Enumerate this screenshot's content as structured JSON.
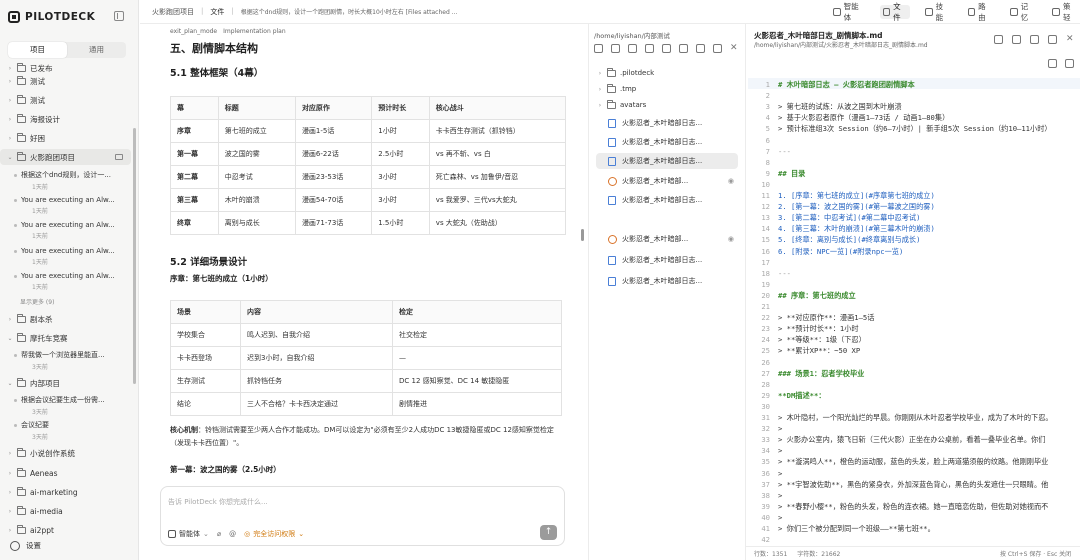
{
  "app": {
    "name": "PILOTDECK"
  },
  "sidebar": {
    "tabs": [
      "项目",
      "通用"
    ],
    "items": [
      {
        "label": "已发布",
        "type": "folder"
      },
      {
        "label": "测试",
        "type": "folder"
      },
      {
        "label": "测试",
        "type": "folder"
      },
      {
        "label": "海报设计",
        "type": "folder"
      },
      {
        "label": "好困",
        "type": "folder"
      },
      {
        "label": "火影跑团项目",
        "type": "folder-open"
      }
    ],
    "conversations": [
      {
        "title": "根据这个dnd规则，设计一...",
        "time": "1天前"
      },
      {
        "title": "You are executing an Alw...",
        "time": "1天前"
      },
      {
        "title": "You are executing an Alw...",
        "time": "1天前"
      },
      {
        "title": "You are executing an Alw...",
        "time": "1天前"
      },
      {
        "title": "You are executing an Alw...",
        "time": "1天前"
      }
    ],
    "show_more": "显示更多 (9)",
    "items2": [
      {
        "label": "剧本杀"
      },
      {
        "label": "摩托车竞赛"
      }
    ],
    "conv2": {
      "title": "帮我做一个浏览器里能直...",
      "time": "3天前"
    },
    "items3": [
      {
        "label": "内部项目"
      }
    ],
    "conv3": [
      {
        "title": "根据会议纪要生成一份需...",
        "time": "3天前"
      },
      {
        "title": "会议纪要",
        "time": "3天前"
      }
    ],
    "items4": [
      {
        "label": "小说创作系统"
      },
      {
        "label": "Aeneas"
      },
      {
        "label": "ai-marketing"
      },
      {
        "label": "ai-media"
      },
      {
        "label": "ai2ppt"
      }
    ],
    "settings": "设置"
  },
  "breadcrumb": {
    "project": "火影跑团项目",
    "section": "文件",
    "task": "根据这个dnd规则，设计一个跑团剧情，时长大概10小时左右 [Files attached by u..."
  },
  "topnav": [
    "智能体",
    "文件",
    "技能",
    "路由",
    "记忆",
    "策轻"
  ],
  "doc_header": {
    "mode": "exit_plan_mode",
    "title": "Implementation plan"
  },
  "doc": {
    "h2": "五、剧情脚本结构",
    "h3a": "5.1 整体框架（4幕）",
    "table1": {
      "headers": [
        "幕",
        "标题",
        "对应原作",
        "预计时长",
        "核心战斗"
      ],
      "rows": [
        [
          "序章",
          "第七班的成立",
          "漫画1-5话",
          "1小时",
          "卡卡西生存测试（抓铃铛）"
        ],
        [
          "第一幕",
          "波之国的雾",
          "漫画6-22话",
          "2.5小时",
          "vs 再不斩、vs 白"
        ],
        [
          "第二幕",
          "中忍考试",
          "漫画23-53话",
          "3小时",
          "死亡森林、vs 加鲁伊/音忍"
        ],
        [
          "第三幕",
          "木叶的崩溃",
          "漫画54-70话",
          "3小时",
          "vs 我爱罗、三代vs大蛇丸"
        ],
        [
          "终章",
          "离别与成长",
          "漫画71-73话",
          "1.5小时",
          "vs 大蛇丸（佐助战）"
        ]
      ]
    },
    "h3b": "5.2 详细场景设计",
    "h4a": "序章：第七班的成立（1小时）",
    "table2": {
      "headers": [
        "场景",
        "内容",
        "检定"
      ],
      "rows": [
        [
          "学校集合",
          "鸣人迟到、自我介绍",
          "社交检定"
        ],
        [
          "卡卡西登场",
          "迟到3小时，自我介绍",
          "—"
        ],
        [
          "生存测试",
          "抓铃铛任务",
          "DC 12 感知察觉、DC 14 敏捷隐匿"
        ],
        [
          "结论",
          "三人不合格？卡卡西决定通过",
          "剧情推进"
        ]
      ]
    },
    "core_label": "核心机制",
    "core_text": "：铃铛测试需要至少两人合作才能成功。DM可以设定为\"必须有至少2人成功DC 13敏捷隐匿或DC 12感知察觉检定（发现卡卡西位置）\"。",
    "h4b": "第一幕：波之国的雾（2.5小时）"
  },
  "chat": {
    "placeholder": "告诉 PilotDeck 你想完成什么...",
    "agent": "智能体",
    "permission": "完全访问权限"
  },
  "files": {
    "path": "/home/liyishan/内部测试",
    "items": [
      {
        "name": ".pilotdeck",
        "type": "folder"
      },
      {
        "name": ".tmp",
        "type": "folder"
      },
      {
        "name": "avatars",
        "type": "folder"
      },
      {
        "name": "火影忍者_木叶暗部日志...",
        "type": "doc"
      },
      {
        "name": "火影忍者_木叶暗部日志...",
        "type": "doc"
      },
      {
        "name": "火影忍者_木叶暗部日志...",
        "type": "doc",
        "selected": true
      },
      {
        "name": "火影忍者_木叶暗部...",
        "type": "web",
        "eye": true
      },
      {
        "name": "火影忍者_木叶暗部日志...",
        "type": "doc"
      },
      {
        "name": "火影忍者_木叶暗部...",
        "type": "web",
        "eye": true
      },
      {
        "name": "火影忍者_木叶暗部日志...",
        "type": "doc"
      },
      {
        "name": "火影忍者_木叶暗部日志...",
        "type": "doc"
      }
    ]
  },
  "editor": {
    "title": "火影忍者_木叶暗部日志_剧情脚本.md",
    "path": "/home/liyishan/内部测试/火影忍者_木叶暗部日志_剧情脚本.md",
    "lines": [
      {
        "n": "1",
        "t": "# 木叶暗部日志 — 火影忍者跑团剧情脚本",
        "k": "h"
      },
      {
        "n": "2",
        "t": "",
        "k": ""
      },
      {
        "n": "3",
        "t": "> 第七班的试炼：从波之国到木叶崩溃",
        "k": ""
      },
      {
        "n": "4",
        "t": "> 基于火影忍者原作（漫画1—73话 / 动画1—80集）",
        "k": ""
      },
      {
        "n": "5",
        "t": "> 预计标准组3次 Session（约6—7小时）| 新手组5次 Session（约10—11小时）",
        "k": ""
      },
      {
        "n": "6",
        "t": "",
        "k": ""
      },
      {
        "n": "7",
        "t": "---",
        "k": "hr"
      },
      {
        "n": "8",
        "t": "",
        "k": ""
      },
      {
        "n": "9",
        "t": "## 目录",
        "k": "h"
      },
      {
        "n": "10",
        "t": "",
        "k": ""
      },
      {
        "n": "11",
        "t": "1. [序章：第七班的成立](#序章第七班的成立)",
        "k": "link"
      },
      {
        "n": "12",
        "t": "2. [第一幕：波之国的雾](#第一幕波之国的雾)",
        "k": "link"
      },
      {
        "n": "13",
        "t": "3. [第二幕：中忍考试](#第二幕中忍考试)",
        "k": "link"
      },
      {
        "n": "14",
        "t": "4. [第三幕：木叶的崩溃](#第三幕木叶的崩溃)",
        "k": "link"
      },
      {
        "n": "15",
        "t": "5. [终章：离别与成长](#终章离别与成长)",
        "k": "link"
      },
      {
        "n": "16",
        "t": "6. [附录：NPC一览](#附录npc一览)",
        "k": "link"
      },
      {
        "n": "17",
        "t": "",
        "k": ""
      },
      {
        "n": "18",
        "t": "---",
        "k": "hr"
      },
      {
        "n": "19",
        "t": "",
        "k": ""
      },
      {
        "n": "20",
        "t": "## 序章：第七班的成立",
        "k": "h"
      },
      {
        "n": "21",
        "t": "",
        "k": ""
      },
      {
        "n": "22",
        "t": "> **对应原作**：漫画1—5话",
        "k": ""
      },
      {
        "n": "23",
        "t": "> **预计时长**：1小时",
        "k": ""
      },
      {
        "n": "24",
        "t": "> **等级**：1级（下忍）",
        "k": ""
      },
      {
        "n": "25",
        "t": "> **累计XP**：~50 XP",
        "k": ""
      },
      {
        "n": "26",
        "t": "",
        "k": ""
      },
      {
        "n": "27",
        "t": "### 场景1：忍者学校毕业",
        "k": "h"
      },
      {
        "n": "28",
        "t": "",
        "k": ""
      },
      {
        "n": "29",
        "t": "**DM描述**：",
        "k": "h"
      },
      {
        "n": "30",
        "t": "",
        "k": ""
      },
      {
        "n": "31",
        "t": "> 木叶隐村，一个阳光灿烂的早晨。你刚刚从木叶忍者学校毕业，成为了木叶的下忍。",
        "k": ""
      },
      {
        "n": "32",
        "t": ">",
        "k": ""
      },
      {
        "n": "33",
        "t": "> 火影办公室内，猿飞日斩（三代火影）正坐在办公桌前，看着一叠毕业名单。你们",
        "k": ""
      },
      {
        "n": "34",
        "t": ">",
        "k": ""
      },
      {
        "n": "35",
        "t": "> **漩涡鸣人**，橙色的运动服，蓝色的头发，脸上两道猫须般的纹路。他刚刚毕业",
        "k": ""
      },
      {
        "n": "36",
        "t": ">",
        "k": ""
      },
      {
        "n": "37",
        "t": "> **宇智波佐助**，黑色的紧身衣，外加深蓝色背心，黑色的头发遮住一只眼睛。他",
        "k": ""
      },
      {
        "n": "38",
        "t": ">",
        "k": ""
      },
      {
        "n": "39",
        "t": "> **春野小樱**，粉色的头发，粉色的连衣裙。她一直暗恋佐助，但佐助对她视而不",
        "k": ""
      },
      {
        "n": "40",
        "t": ">",
        "k": ""
      },
      {
        "n": "41",
        "t": "> 你们三个被分配到同一个班级——**第七班**。",
        "k": ""
      },
      {
        "n": "42",
        "t": "",
        "k": ""
      }
    ],
    "status_left": [
      "行数：1351",
      "字符数：21662"
    ],
    "status_right": "按 Ctrl+S 保存 · Esc 关闭"
  }
}
